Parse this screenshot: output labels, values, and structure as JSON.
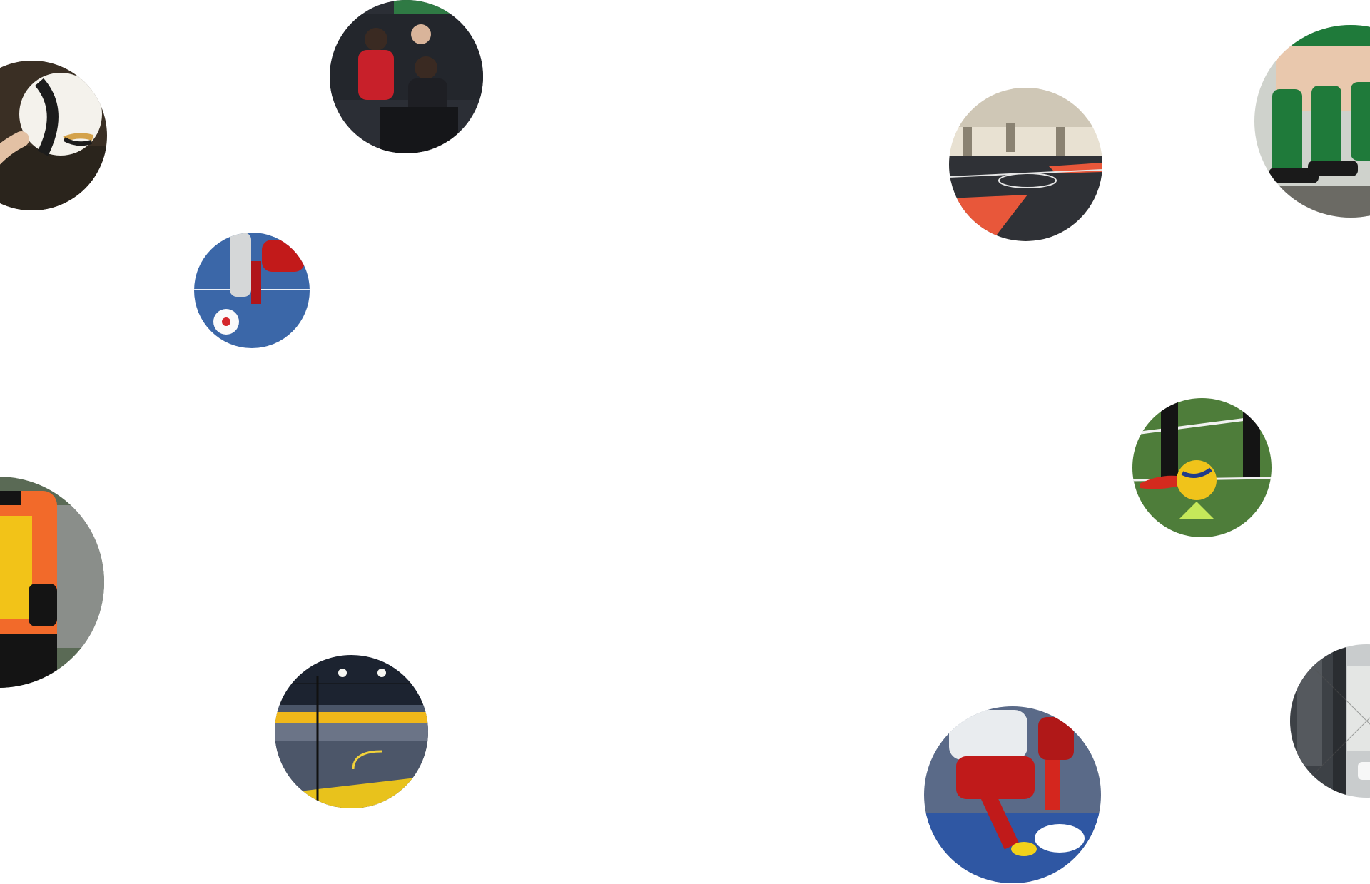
{
  "page": {
    "background": "#ffffff"
  },
  "photos": [
    {
      "id": "ball-on-ground",
      "subject": "ball-on-ground-photo"
    },
    {
      "id": "bench-players",
      "subject": "bench-players-photo"
    },
    {
      "id": "futsal-dribble",
      "subject": "futsal-dribble-photo"
    },
    {
      "id": "indoor-court-orange",
      "subject": "indoor-court-photo"
    },
    {
      "id": "green-socks",
      "subject": "green-socks-photo"
    },
    {
      "id": "training-cone",
      "subject": "training-cone-photo"
    },
    {
      "id": "yellow-bib",
      "subject": "training-bib-photo"
    },
    {
      "id": "caged-pitch",
      "subject": "caged-pitch-photo"
    },
    {
      "id": "spain-player",
      "subject": "futsal-tackle-photo"
    },
    {
      "id": "net-edge",
      "subject": "netted-court-photo"
    }
  ],
  "colors": {
    "pitch_green": "#4e7d3a",
    "court_dark": "#2f3136",
    "court_orange": "#e8573a",
    "futsal_blue": "#3b67a8",
    "bib_yellow": "#f2c318",
    "jersey_red": "#c21a1a",
    "sock_green": "#1f7a3a"
  }
}
